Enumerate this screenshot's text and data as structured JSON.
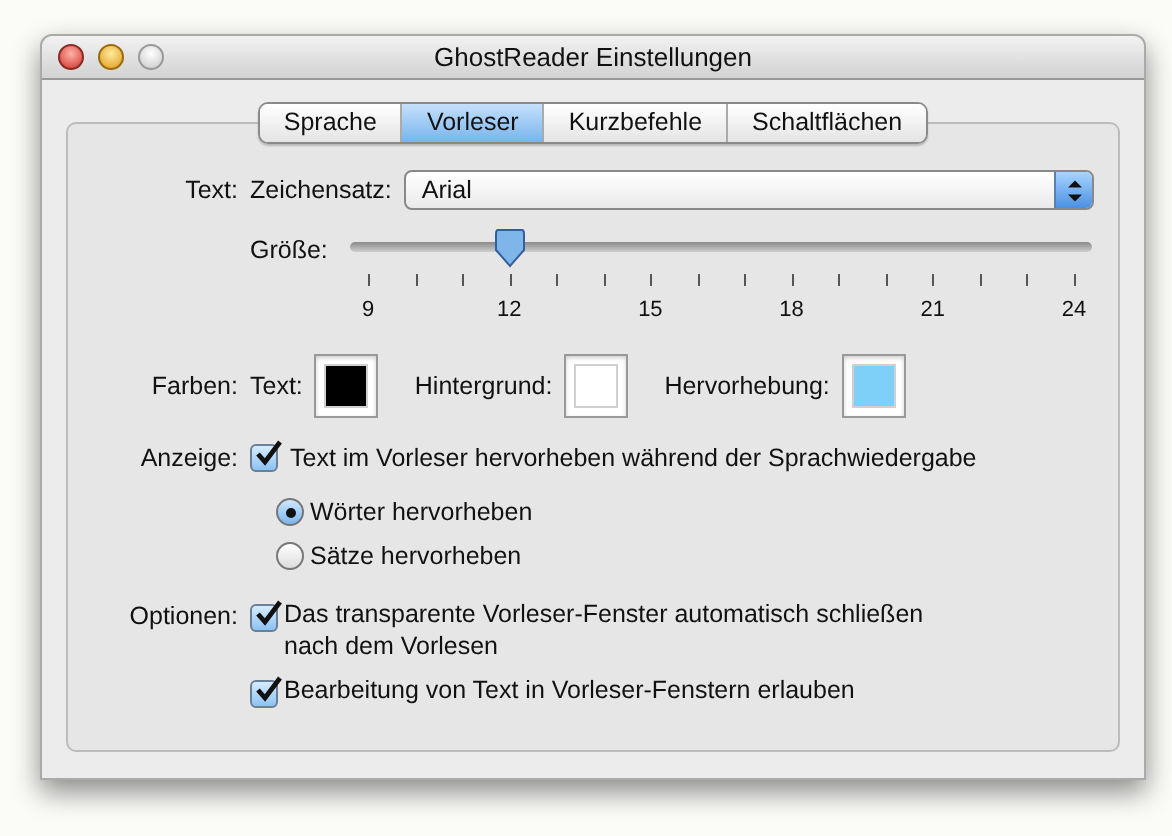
{
  "window": {
    "title": "GhostReader Einstellungen"
  },
  "tabs": [
    {
      "label": "Sprache",
      "selected": false
    },
    {
      "label": "Vorleser",
      "selected": true
    },
    {
      "label": "Kurzbefehle",
      "selected": false
    },
    {
      "label": "Schaltflächen",
      "selected": false
    }
  ],
  "text_section": {
    "label": "Text:",
    "font_label": "Zeichensatz:",
    "font_value": "Arial",
    "size_label": "Größe:",
    "size_slider": {
      "level": 0.2,
      "tick_labels": [
        "9",
        "12",
        "15",
        "18",
        "21",
        "24"
      ]
    }
  },
  "colors_section": {
    "label": "Farben:",
    "swatches": [
      {
        "label": "Text:",
        "color": "#000000"
      },
      {
        "label": "Hintergrund:",
        "color": "#ffffff"
      },
      {
        "label": "Hervorhebung:",
        "color": "#7fd0f8"
      }
    ]
  },
  "display_section": {
    "label": "Anzeige:",
    "highlight_checkbox": {
      "label": "Text im Vorleser hervorheben während der Sprachwiedergabe",
      "checked": true
    },
    "radios": [
      {
        "label": "Wörter hervorheben",
        "selected": true
      },
      {
        "label": "Sätze hervorheben",
        "selected": false
      }
    ]
  },
  "options_section": {
    "label": "Optionen:",
    "checkboxes": [
      {
        "label": "Das transparente Vorleser-Fenster automatisch schließen nach dem Vorlesen",
        "checked": true
      },
      {
        "label": "Bearbeitung von Text in Vorleser-Fenstern erlauben",
        "checked": true
      }
    ]
  }
}
